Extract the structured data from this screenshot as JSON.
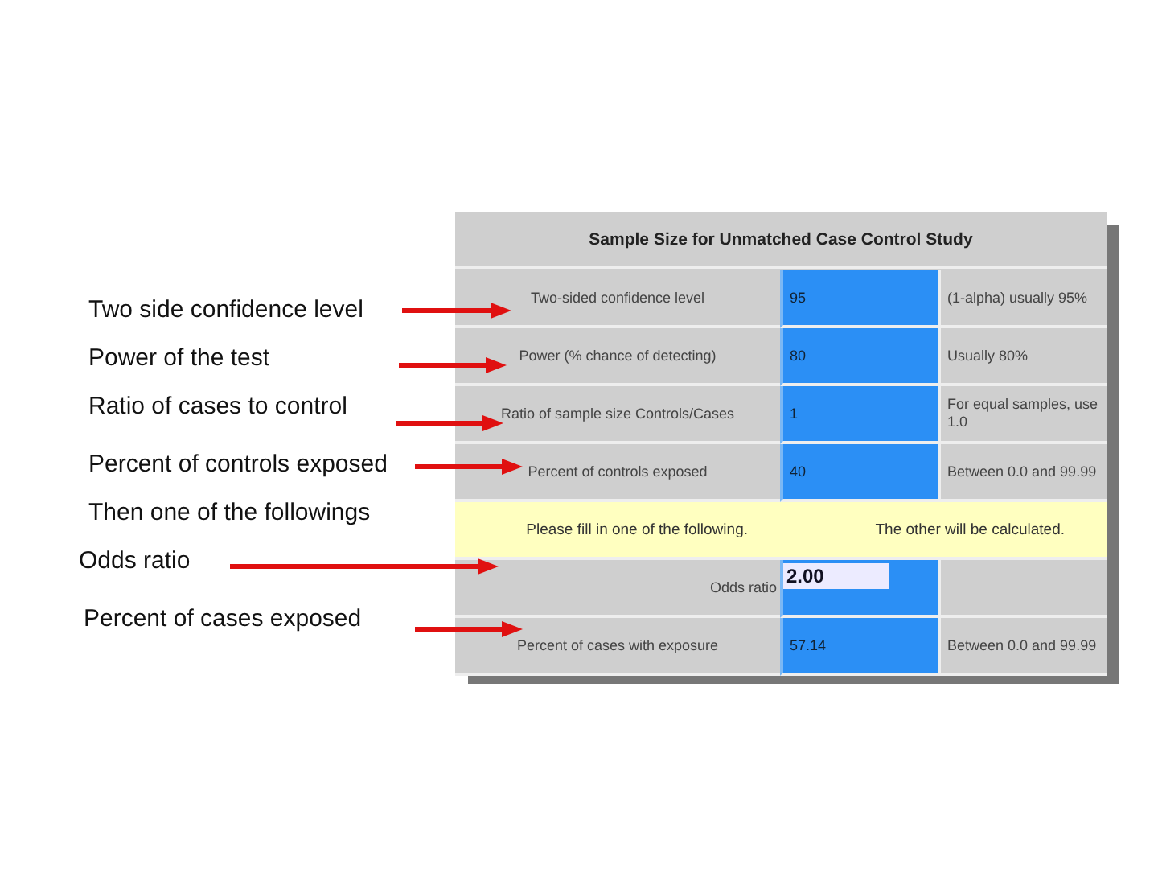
{
  "annotations": [
    {
      "text": "Two side confidence level"
    },
    {
      "text": "Power of the test"
    },
    {
      "text": "Ratio of cases to control"
    },
    {
      "text": "Percent of controls exposed"
    },
    {
      "text": "Then one of the followings"
    },
    {
      "text": "Odds ratio"
    },
    {
      "text": "Percent of cases exposed"
    }
  ],
  "panel": {
    "title": "Sample Size for Unmatched Case Control Study",
    "rows": [
      {
        "kind": "field",
        "label": "Two-sided  confidence level",
        "value": "95",
        "hint": "(1-alpha) usually 95%"
      },
      {
        "kind": "field",
        "label": "Power (% chance  of detecting)",
        "value": "80",
        "hint": "Usually 80%"
      },
      {
        "kind": "field",
        "label": "Ratio of sample size  Controls/Cases",
        "value": "1",
        "hint": "For equal samples, use 1.0"
      },
      {
        "kind": "field",
        "label": "Percent of  controls exposed",
        "value": "40",
        "hint": "Between 0.0 and 99.99"
      },
      {
        "kind": "notice",
        "left": "Please fill in  one of the following.",
        "right": "The other  will be calculated."
      },
      {
        "kind": "input",
        "label": "Odds ratio",
        "value": "2.00"
      },
      {
        "kind": "field",
        "label": "Percent of  cases with exposure",
        "value": "57.14",
        "hint": "Between 0.0 and 99.99"
      }
    ]
  }
}
